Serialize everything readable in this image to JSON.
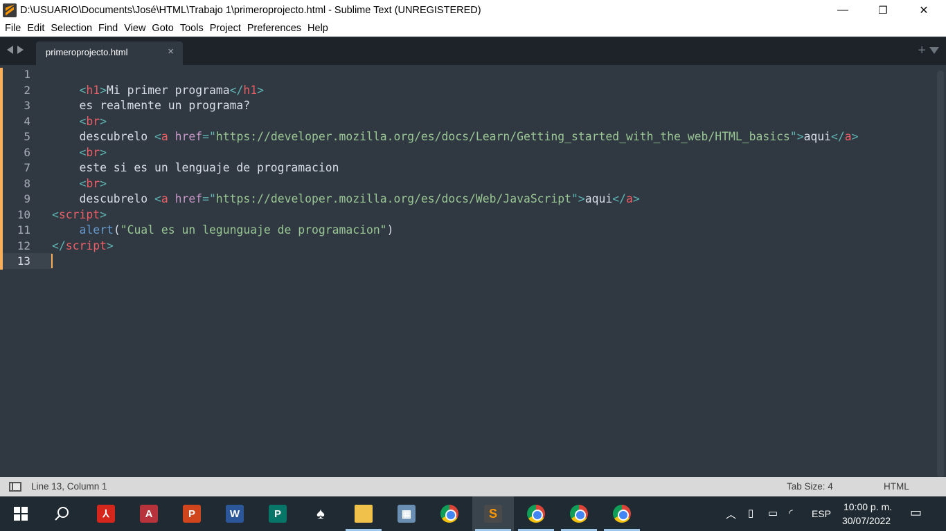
{
  "window": {
    "title": "D:\\USUARIO\\Documents\\José\\HTML\\Trabajo 1\\primeroprojecto.html - Sublime Text (UNREGISTERED)",
    "minimize": "—",
    "maximize": "❐",
    "close": "✕"
  },
  "menu": [
    "File",
    "Edit",
    "Selection",
    "Find",
    "View",
    "Goto",
    "Tools",
    "Project",
    "Preferences",
    "Help"
  ],
  "tabs": {
    "active_label": "primeroprojecto.html",
    "close_glyph": "×",
    "new_tab_glyph": "+"
  },
  "editor": {
    "line_numbers": [
      "1",
      "2",
      "3",
      "4",
      "5",
      "6",
      "7",
      "8",
      "9",
      "10",
      "11",
      "12",
      "13"
    ],
    "active_line": 13
  },
  "status": {
    "position": "Line 13, Column 1",
    "tab_size": "Tab Size: 4",
    "syntax": "HTML"
  },
  "taskbar": {
    "language": "ESP",
    "time": "10:00 p. m.",
    "date": "30/07/2022"
  },
  "colors": {
    "editor_bg": "#303841",
    "tab_strip_bg": "#1d2328",
    "tag": "#ec5f66",
    "punctuation": "#5fb4b4",
    "attribute": "#c695c6",
    "string": "#99c794",
    "function": "#6699cc",
    "modified_marker": "#f9ae58"
  }
}
